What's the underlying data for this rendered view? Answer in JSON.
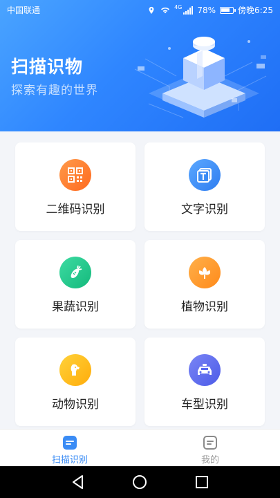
{
  "status_bar": {
    "carrier": "中国联通",
    "battery": "78%",
    "time": "傍晚6:25",
    "network": "4G"
  },
  "hero": {
    "title": "扫描识物",
    "subtitle": "探索有趣的世界"
  },
  "cards": [
    {
      "label": "二维码识别",
      "icon": "qr-code-icon",
      "color": "#ff7a2e"
    },
    {
      "label": "文字识别",
      "icon": "text-icon",
      "color": "#3b8cf5"
    },
    {
      "label": "果蔬识别",
      "icon": "vegetable-icon",
      "color": "#23c78d"
    },
    {
      "label": "植物识别",
      "icon": "plant-icon",
      "color": "#ff9a2a"
    },
    {
      "label": "动物识别",
      "icon": "animal-icon",
      "color": "#ffbb1a"
    },
    {
      "label": "车型识别",
      "icon": "car-icon",
      "color": "#5b6cf0"
    }
  ],
  "tabbar": {
    "tabs": [
      {
        "label": "扫描识别",
        "active": true,
        "color": "#3b8cf5"
      },
      {
        "label": "我的",
        "active": false,
        "color": "#9a9a9a"
      }
    ]
  },
  "accent_color": "#2f86ff"
}
